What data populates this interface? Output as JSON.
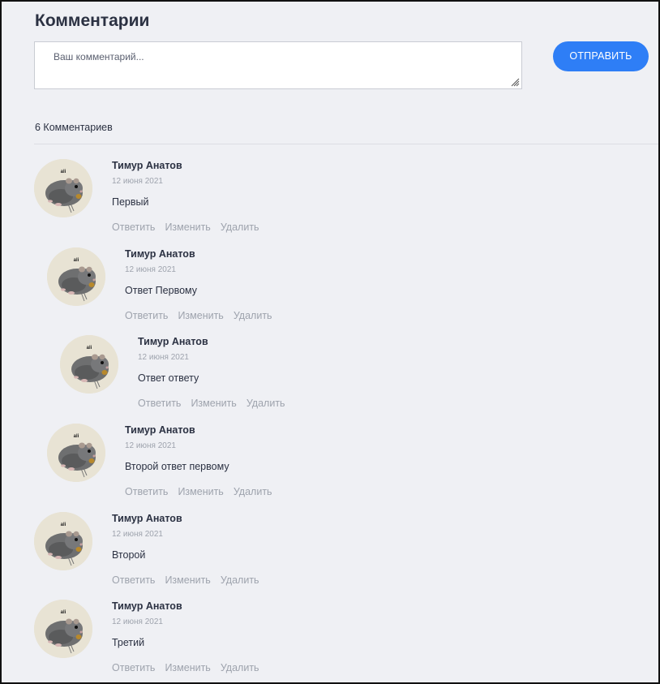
{
  "page": {
    "title": "Комментарии",
    "comment_placeholder": "Ваш комментарий...",
    "send_label": "ОТПРАВИТЬ",
    "comment_count": "6 Комментариев"
  },
  "actions": {
    "reply": "Ответить",
    "edit": "Изменить",
    "delete": "Удалить"
  },
  "avatar_text": "ali",
  "colors": {
    "background": "#eff0f4",
    "accent": "#2e7ef6",
    "text": "#2b3142",
    "muted": "#9ea3ad"
  },
  "comments": [
    {
      "author": "Тимур Анатов",
      "date": "12 июня 2021",
      "text": "Первый",
      "depth": 0
    },
    {
      "author": "Тимур Анатов",
      "date": "12 июня 2021",
      "text": "Ответ Первому",
      "depth": 1
    },
    {
      "author": "Тимур Анатов",
      "date": "12 июня 2021",
      "text": "Ответ ответу",
      "depth": 2
    },
    {
      "author": "Тимур Анатов",
      "date": "12 июня 2021",
      "text": "Второй ответ первому",
      "depth": 1
    },
    {
      "author": "Тимур Анатов",
      "date": "12 июня 2021",
      "text": "Второй",
      "depth": 0
    },
    {
      "author": "Тимур Анатов",
      "date": "12 июня 2021",
      "text": "Третий",
      "depth": 0
    }
  ]
}
